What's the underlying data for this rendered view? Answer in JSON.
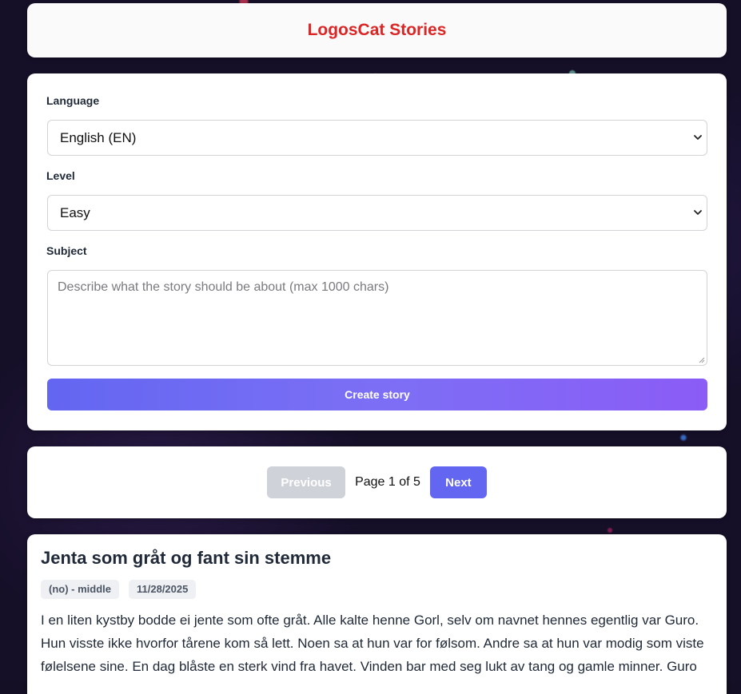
{
  "header": {
    "title": "LogosCat Stories",
    "title_color": "#dc2626"
  },
  "form": {
    "language_label": "Language",
    "language_value": "English (EN)",
    "level_label": "Level",
    "level_value": "Easy",
    "subject_label": "Subject",
    "subject_placeholder": "Describe what the story should be about (max 1000 chars)",
    "create_button": "Create story",
    "accent_color": "#6366f1"
  },
  "pagination": {
    "previous_label": "Previous",
    "page_info": "Page 1 of 5",
    "next_label": "Next",
    "previous_disabled": true
  },
  "story": {
    "title": "Jenta som gråt og fant sin stemme",
    "badges": [
      "(no) - middle",
      "11/28/2025"
    ],
    "text": "I en liten kystby bodde ei jente som ofte gråt. Alle kalte henne Gorl, selv om navnet hennes egentlig var Guro. Hun visste ikke hvorfor tårene kom så lett. Noen sa at hun var for følsom. Andre sa at hun var modig som viste følelsene sine. En dag blåste en sterk vind fra havet. Vinden bar med seg lukt av tang og gamle minner. Guro"
  }
}
